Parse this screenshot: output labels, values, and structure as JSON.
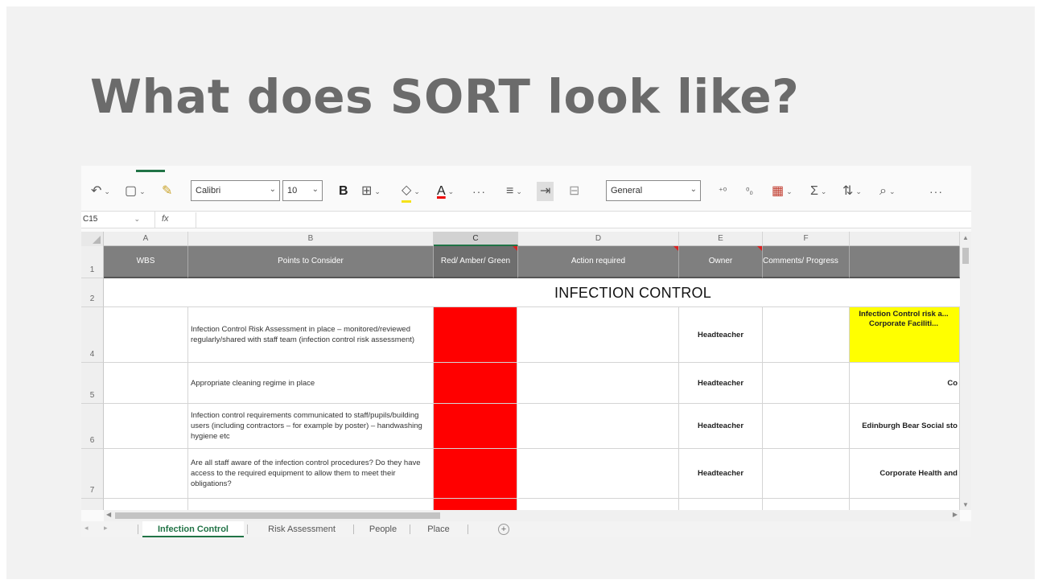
{
  "slide": {
    "title": "What does SORT look like?"
  },
  "ribbon": {
    "undo_icon": "undo-icon",
    "paste_icon": "clipboard-icon",
    "format_painter_icon": "format-painter-icon",
    "font_name": "Calibri",
    "font_size": "10",
    "bold_label": "B",
    "font_color_label": "A",
    "more_label": "···",
    "number_format": "General",
    "more_label_2": "···"
  },
  "formula_bar": {
    "name_box": "C15",
    "fx_label": "fx",
    "formula": ""
  },
  "grid": {
    "columns": [
      "A",
      "B",
      "C",
      "D",
      "E",
      "F"
    ],
    "header": {
      "a": "WBS",
      "b": "Points to Consider",
      "c": "Red/ Amber/ Green",
      "d": "Action required",
      "e": "Owner",
      "f": "Comments/ Progress",
      "g": ""
    },
    "section_title": "INFECTION CONTROL",
    "row_numbers": [
      "1",
      "2",
      "4",
      "5",
      "6",
      "7"
    ],
    "rows": [
      {
        "points": "Infection Control Risk Assessment in place – monitored/reviewed regularly/shared with staff team (infection control risk assessment)",
        "owner": "Headteacher",
        "ref": "Infection Control risk a... Corporate Faciliti..."
      },
      {
        "points": "Appropriate cleaning regime in place",
        "owner": "Headteacher",
        "ref": "Co"
      },
      {
        "points": "Infection control requirements communicated to staff/pupils/building users (including contractors – for example by poster) – handwashing hygiene etc",
        "owner": "Headteacher",
        "ref": "Edinburgh Bear Social sto"
      },
      {
        "points": "Are all staff aware of the infection control procedures? Do they have access to the required equipment to allow them to meet their obligations?",
        "owner": "Headteacher",
        "ref": "Corporate Health and"
      }
    ],
    "rag_color": "#ff0000",
    "header_color": "#7f7f7f"
  },
  "tabs": {
    "sheets": [
      "Infection Control",
      "Risk Assessment",
      "People",
      "Place"
    ],
    "active": "Infection Control",
    "add_label": "+"
  },
  "colors": {
    "excel_green": "#217346",
    "yellow_highlight": "#ffff00"
  }
}
